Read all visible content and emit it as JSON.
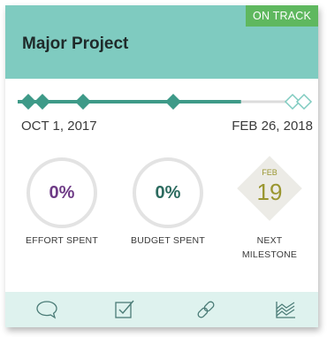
{
  "project": {
    "title": "Major Project",
    "status": "ON TRACK"
  },
  "timeline": {
    "start_date": "OCT 1, 2017",
    "end_date": "FEB 26, 2018",
    "progress_fraction": 0.78
  },
  "metrics": {
    "effort": {
      "value": "0%",
      "label": "EFFORT SPENT"
    },
    "budget": {
      "value": "0%",
      "label": "BUDGET SPENT"
    }
  },
  "next_milestone": {
    "month": "FEB",
    "day": "19",
    "label_line1": "NEXT",
    "label_line2": "MILESTONE"
  },
  "footer": {
    "icons": [
      "comment-icon",
      "checkbox-icon",
      "link-icon",
      "chart-icon"
    ]
  },
  "colors": {
    "header": "#7fcbc0",
    "status": "#5fb85f",
    "timeline": "#3e9a88",
    "effort_text": "#6e3b86",
    "budget_text": "#2c6b5f",
    "milestone_text": "#9a9630",
    "footer": "#def2ee"
  }
}
